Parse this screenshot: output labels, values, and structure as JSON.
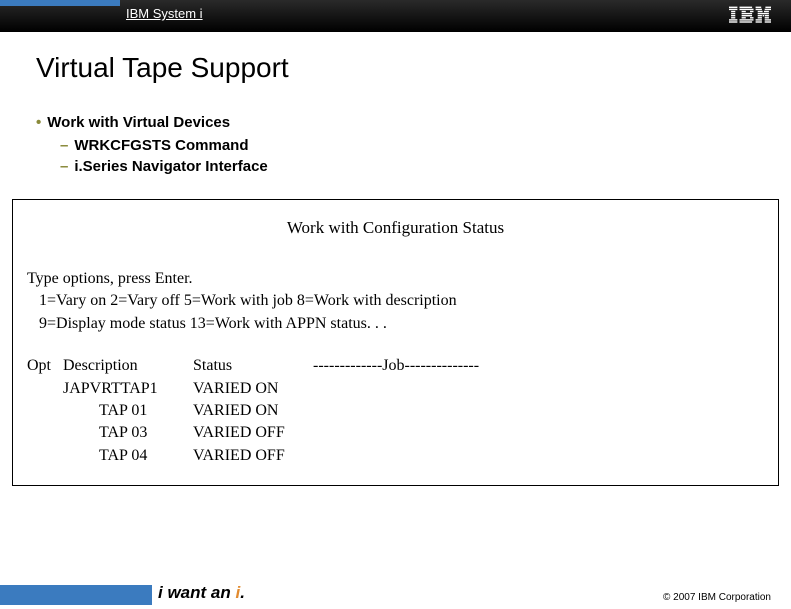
{
  "header": {
    "product_line": "IBM System i",
    "logo_label": "IBM"
  },
  "title": "Virtual Tape Support",
  "bullets": {
    "main": "Work with Virtual Devices",
    "sub1": "WRKCFGSTS Command",
    "sub2": "i.Series Navigator Interface"
  },
  "panel": {
    "heading": "Work with Configuration Status",
    "instructions_l1": "Type options, press Enter.",
    "instructions_l2": "1=Vary on   2=Vary off   5=Work with job   8=Work with description",
    "instructions_l3": "9=Display mode status   13=Work with APPN status. . .",
    "columns": {
      "opt": "Opt",
      "desc": "Description",
      "status": "Status",
      "job": "-------------Job--------------"
    },
    "rows": [
      {
        "desc": "JAPVRTTAP1",
        "status": "VARIED ON"
      },
      {
        "desc": "TAP 01",
        "status": "VARIED ON"
      },
      {
        "desc": "TAP 03",
        "status": "VARIED OFF"
      },
      {
        "desc": "TAP 04",
        "status": "VARIED OFF"
      }
    ]
  },
  "footer": {
    "tagline_prefix": "i want an ",
    "tagline_em": "i",
    "tagline_suffix": ".",
    "copyright": "© 2007 IBM Corporation"
  }
}
